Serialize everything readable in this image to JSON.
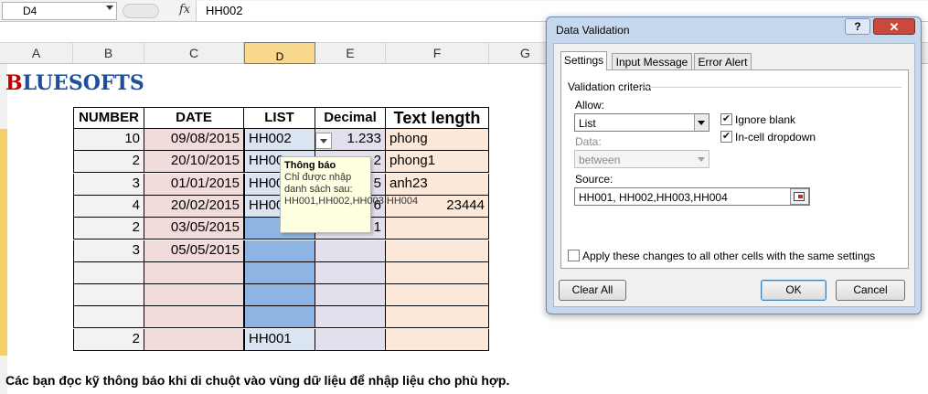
{
  "formula_bar": {
    "name_box": "D4",
    "fx": "fx",
    "formula": "HH002"
  },
  "columns": [
    "A",
    "B",
    "C",
    "D",
    "E",
    "F",
    "G"
  ],
  "logo": {
    "prefix": "B",
    "rest": "LUESOFTS"
  },
  "table": {
    "headers": [
      "NUMBER",
      "DATE",
      "LIST",
      "Decimal",
      "Text length"
    ],
    "rows": [
      [
        "10",
        "09/08/2015",
        "HH002",
        "1.233",
        "phong"
      ],
      [
        "2",
        "20/10/2015",
        "HH00",
        "2",
        "phong1"
      ],
      [
        "3",
        "01/01/2015",
        "HH00",
        "5",
        "anh23"
      ],
      [
        "4",
        "20/02/2015",
        "HH00",
        "6",
        "23444"
      ],
      [
        "2",
        "03/05/2015",
        "",
        "1",
        ""
      ],
      [
        "3",
        "05/05/2015",
        "",
        "",
        ""
      ],
      [
        "",
        "",
        "",
        "",
        ""
      ],
      [
        "",
        "",
        "",
        "",
        ""
      ],
      [
        "",
        "",
        "",
        "",
        ""
      ],
      [
        "2",
        "",
        "HH001",
        "",
        ""
      ]
    ]
  },
  "tooltip": {
    "title": "Thông báo",
    "body": "Chỉ được nhập danh sách sau: HH001,HH002,HH003,HH004"
  },
  "caption": "Các bạn đọc kỹ thông báo khi di chuột vào vùng dữ liệu để nhập liệu cho phù hợp.",
  "dialog": {
    "title": "Data Validation",
    "help": "?",
    "close": "✕",
    "tabs": [
      "Settings",
      "Input Message",
      "Error Alert"
    ],
    "group_label": "Validation criteria",
    "allow_label": "Allow:",
    "allow_value": "List",
    "data_label": "Data:",
    "data_value": "between",
    "ignore_blank": "Ignore blank",
    "in_cell_dropdown": "In-cell dropdown",
    "source_label": "Source:",
    "source_value": "HH001, HH002,HH003,HH004",
    "apply_all": "Apply these changes to all other cells with the same settings",
    "clear_all": "Clear All",
    "ok": "OK",
    "cancel": "Cancel"
  }
}
